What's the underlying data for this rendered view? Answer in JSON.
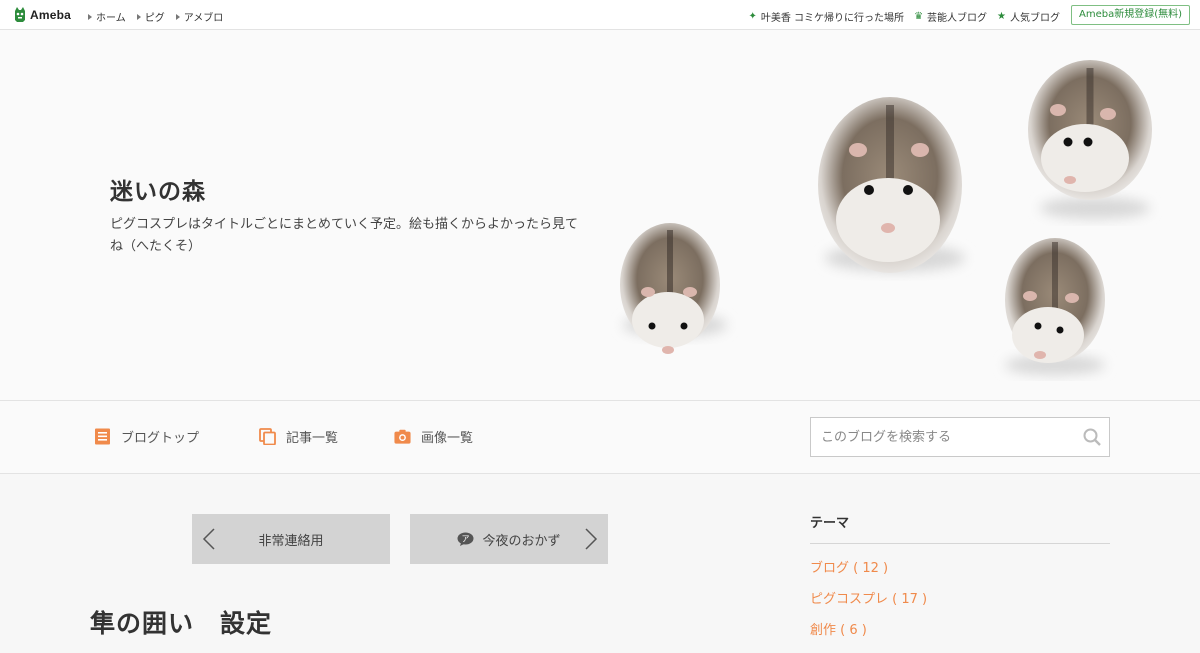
{
  "header": {
    "logo_text": "Ameba",
    "nav": [
      "ホーム",
      "ピグ",
      "アメブロ"
    ],
    "right_links": [
      {
        "icon": "sparkle-icon",
        "label": "叶美香 コミケ帰りに行った場所"
      },
      {
        "icon": "crown-icon",
        "label": "芸能人ブログ"
      },
      {
        "icon": "star-icon",
        "label": "人気ブログ"
      }
    ],
    "register_label": "Ameba新規登録(無料)"
  },
  "hero": {
    "title": "迷いの森",
    "description": "ピグコスプレはタイトルごとにまとめていく予定。絵も描くからよかったら見てね（へたくそ）"
  },
  "blog_nav": {
    "items": [
      {
        "icon": "document-icon",
        "label": "ブログトップ"
      },
      {
        "icon": "pages-icon",
        "label": "記事一覧"
      },
      {
        "icon": "camera-icon",
        "label": "画像一覧"
      }
    ],
    "search_placeholder": "このブログを検索する"
  },
  "pager": {
    "prev_label": "非常連絡用",
    "next_label": "今夜のおかず"
  },
  "entry": {
    "title": "隼の囲い　設定"
  },
  "sidebar": {
    "heading": "テーマ",
    "themes": [
      "ブログ ( 12 )",
      "ピグコスプレ ( 17 )",
      "創作 ( 6 )"
    ]
  },
  "colors": {
    "accent_orange": "#f08a4b",
    "ameba_green": "#2d8c3c",
    "pager_bg": "#d3d3d3"
  }
}
